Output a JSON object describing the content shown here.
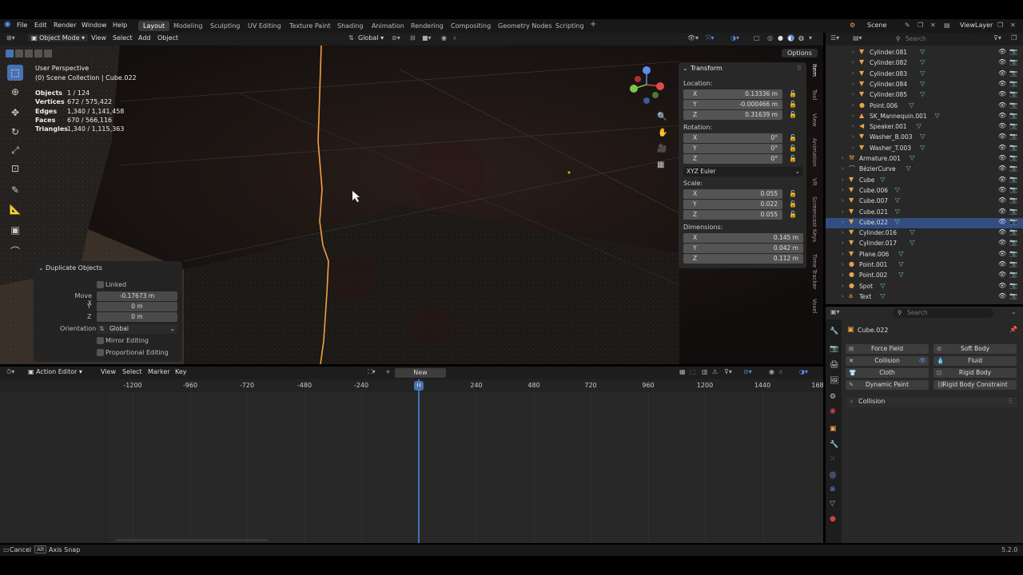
{
  "topbar": {
    "menus": [
      "File",
      "Edit",
      "Render",
      "Window",
      "Help"
    ],
    "workspaces": [
      "Layout",
      "Modeling",
      "Sculpting",
      "UV Editing",
      "Texture Paint",
      "Shading",
      "Animation",
      "Rendering",
      "Compositing",
      "Geometry Nodes",
      "Scripting"
    ],
    "active_workspace": "Layout",
    "add_tab": "+",
    "scene": "Scene",
    "viewlayer": "ViewLayer"
  },
  "viewport_header": {
    "mode": "Object Mode",
    "menus": [
      "View",
      "Select",
      "Add",
      "Object"
    ],
    "orientation": "Global",
    "options": "Options"
  },
  "viewport": {
    "title": "User Perspective",
    "subtitle": "(0) Scene Collection | Cube.022",
    "stats": [
      {
        "label": "Objects",
        "value": "1 / 124"
      },
      {
        "label": "Vertices",
        "value": "672 / 575,422"
      },
      {
        "label": "Edges",
        "value": "1,340 / 1,141,458"
      },
      {
        "label": "Faces",
        "value": "670 / 566,116"
      },
      {
        "label": "Triangles",
        "value": "1,340 / 1,115,363"
      }
    ]
  },
  "transform": {
    "title": "Transform",
    "location_label": "Location:",
    "location": [
      {
        "ax": "X",
        "v": "0.13336 m"
      },
      {
        "ax": "Y",
        "v": "-0.000466 m"
      },
      {
        "ax": "Z",
        "v": "0.31639 m"
      }
    ],
    "rotation_label": "Rotation:",
    "rotation": [
      {
        "ax": "X",
        "v": "0°"
      },
      {
        "ax": "Y",
        "v": "0°"
      },
      {
        "ax": "Z",
        "v": "0°"
      }
    ],
    "rotation_mode": "XYZ Euler",
    "scale_label": "Scale:",
    "scale": [
      {
        "ax": "X",
        "v": "0.055"
      },
      {
        "ax": "Y",
        "v": "0.022"
      },
      {
        "ax": "Z",
        "v": "0.055"
      }
    ],
    "dimensions_label": "Dimensions:",
    "dimensions": [
      {
        "ax": "X",
        "v": "0.145 m"
      },
      {
        "ax": "Y",
        "v": "0.042 m"
      },
      {
        "ax": "Z",
        "v": "0.112 m"
      }
    ]
  },
  "side_tabs": [
    "Item",
    "Tool",
    "View",
    "Animation",
    "VR",
    "Screencast Keys",
    "Time Tracker",
    "Voxel"
  ],
  "duplicate": {
    "title": "Duplicate Objects",
    "linked": "Linked",
    "move_x_label": "Move X",
    "move_x": "-0.17673 m",
    "y_label": "Y",
    "y": "0 m",
    "z_label": "Z",
    "z": "0 m",
    "orientation_label": "Orientation",
    "orientation": "Global",
    "mirror": "Mirror Editing",
    "proportional": "Proportional Editing"
  },
  "action_editor": {
    "mode": "Action Editor",
    "menus": [
      "View",
      "Select",
      "Marker",
      "Key"
    ],
    "new_button": "New",
    "ticks": [
      "-1200",
      "-960",
      "-720",
      "-480",
      "-240",
      "0",
      "240",
      "480",
      "720",
      "960",
      "1200",
      "1440",
      "168"
    ],
    "current_frame": "0"
  },
  "outliner": {
    "search_placeholder": "Search",
    "rows": [
      {
        "name": "Cylinder.081",
        "indent": 1
      },
      {
        "name": "Cylinder.082",
        "indent": 1
      },
      {
        "name": "Cylinder.083",
        "indent": 1
      },
      {
        "name": "Cylinder.084",
        "indent": 1
      },
      {
        "name": "Cylinder.085",
        "indent": 1
      },
      {
        "name": "Point.006",
        "indent": 1
      },
      {
        "name": "SK_Mannequin.001",
        "indent": 1
      },
      {
        "name": "Speaker.001",
        "indent": 1
      },
      {
        "name": "Washer_B.003",
        "indent": 1
      },
      {
        "name": "Washer_T.003",
        "indent": 1
      },
      {
        "name": "Armature.001",
        "indent": 0
      },
      {
        "name": "BézierCurve",
        "indent": 0
      },
      {
        "name": "Cube",
        "indent": 0
      },
      {
        "name": "Cube.006",
        "indent": 0
      },
      {
        "name": "Cube.007",
        "indent": 0
      },
      {
        "name": "Cube.021",
        "indent": 0
      },
      {
        "name": "Cube.022",
        "indent": 0,
        "selected": true
      },
      {
        "name": "Cylinder.016",
        "indent": 0
      },
      {
        "name": "Cylinder.017",
        "indent": 0
      },
      {
        "name": "Plane.006",
        "indent": 0
      },
      {
        "name": "Point.001",
        "indent": 0
      },
      {
        "name": "Point.002",
        "indent": 0
      },
      {
        "name": "Spot",
        "indent": 0
      },
      {
        "name": "Text",
        "indent": 0
      }
    ]
  },
  "properties": {
    "search_placeholder": "Search",
    "object_name": "Cube.022",
    "buttons": [
      [
        "Force Field",
        "Soft Body"
      ],
      [
        "Collision",
        "Fluid"
      ],
      [
        "Cloth",
        "Rigid Body"
      ],
      [
        "Dynamic Paint",
        "Rigid Body Constraint"
      ]
    ],
    "section": "Collision"
  },
  "statusbar": {
    "cancel": "Cancel",
    "alt_key": "Alt",
    "axis_snap": "Axis Snap",
    "version": "5.2.0"
  }
}
